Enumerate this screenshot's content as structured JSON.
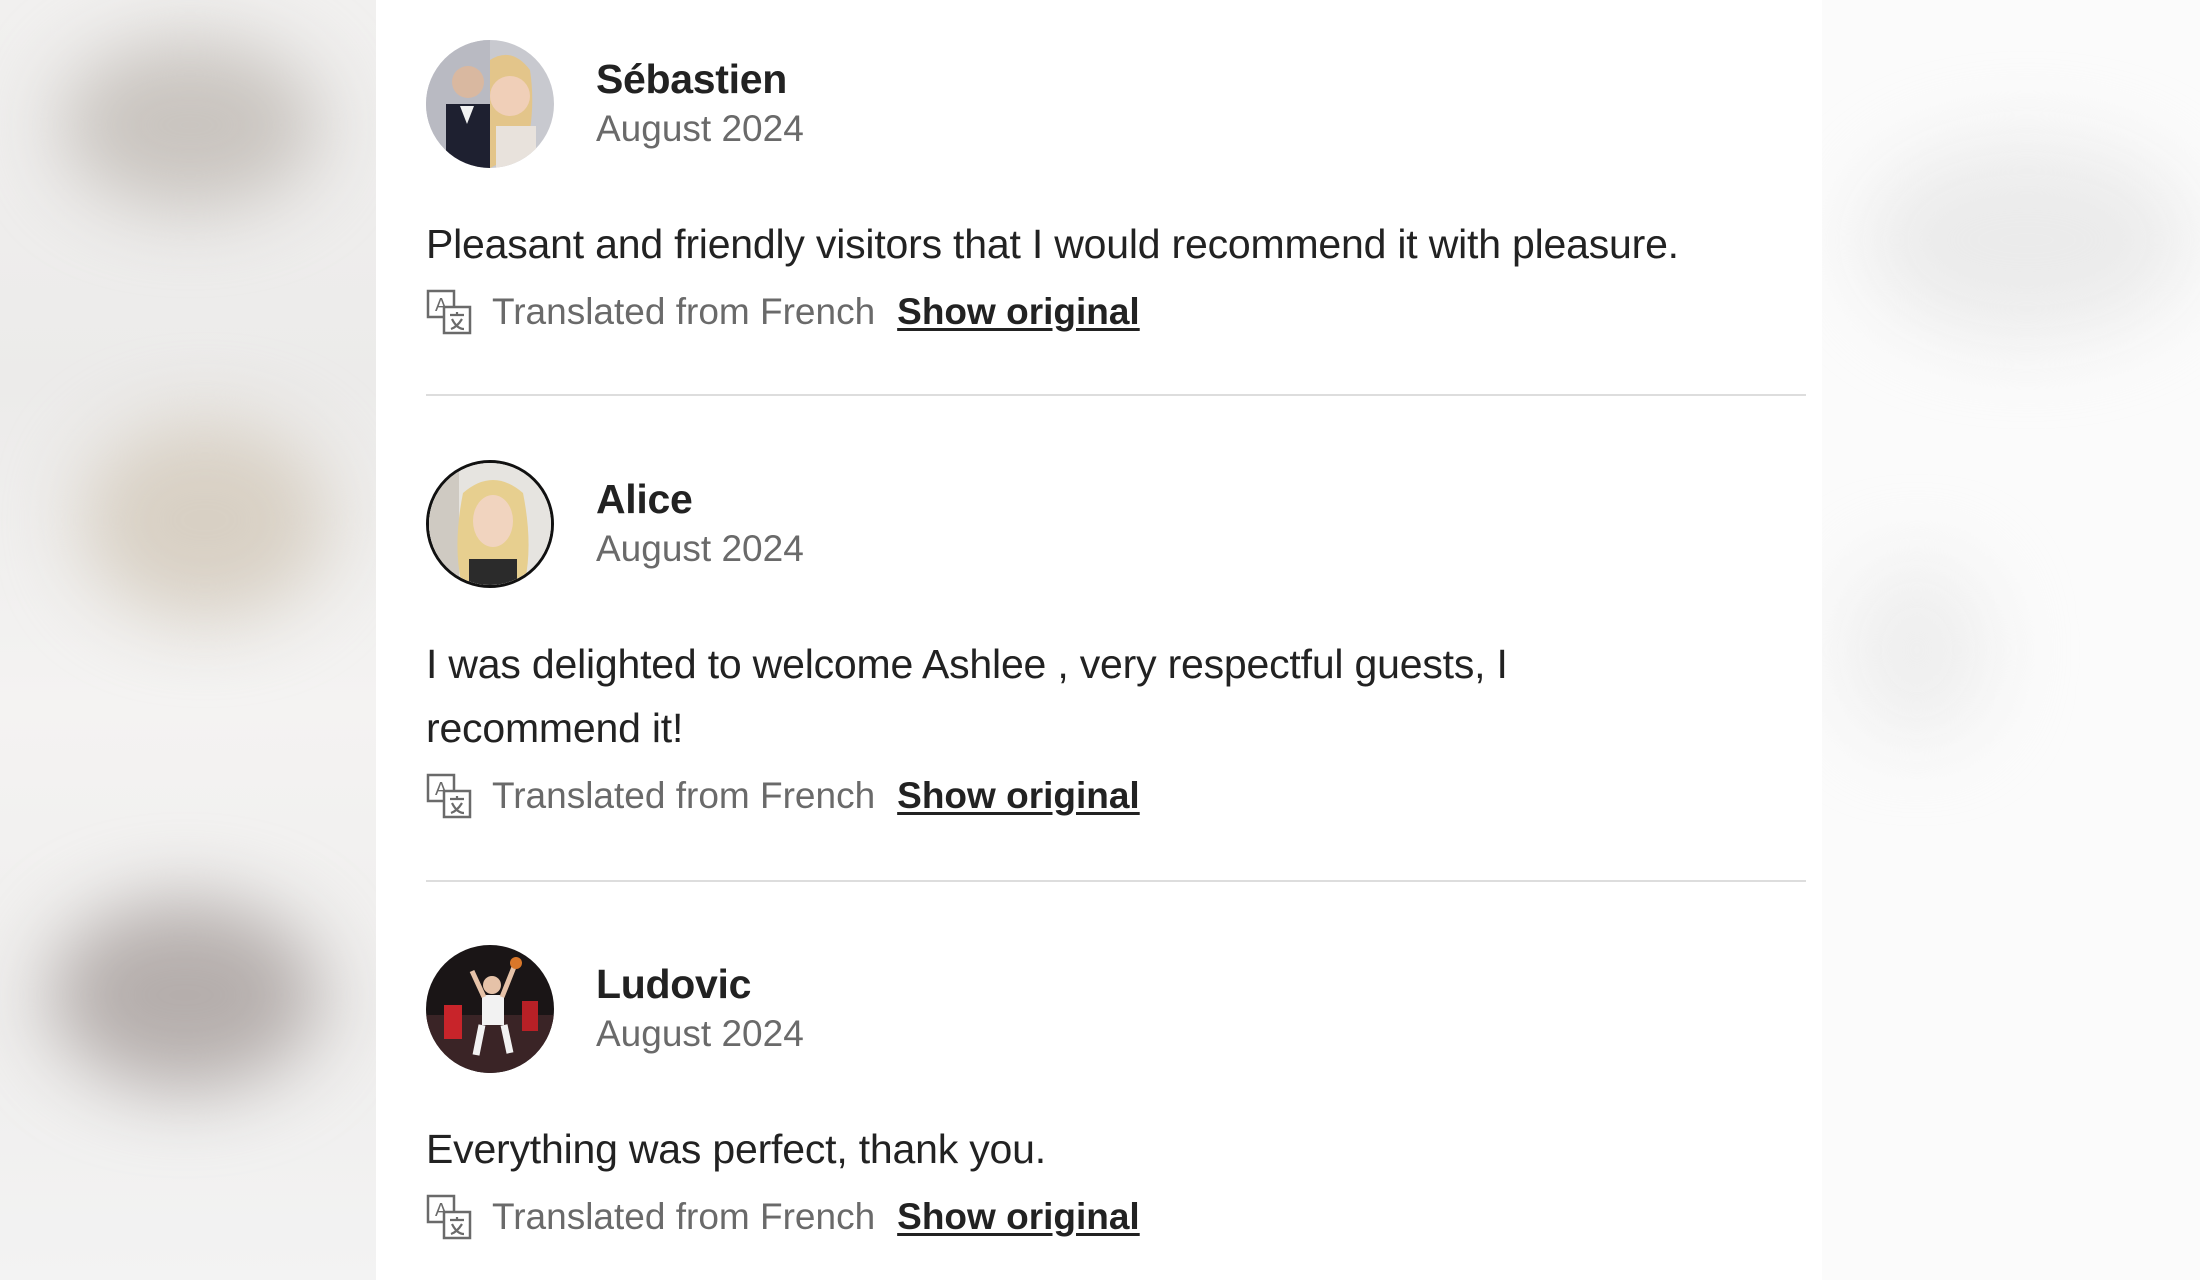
{
  "reviews": [
    {
      "name": "Sébastien",
      "date": "August 2024",
      "text": "Pleasant and friendly visitors that I would recommend it with pleasure.",
      "translated_label": "Translated from French",
      "show_original_label": "Show original",
      "avatar_icon": "couple-photo-avatar"
    },
    {
      "name": "Alice",
      "date": "August 2024",
      "text": "I was delighted to welcome Ashlee , very respectful guests, I recommend it!",
      "translated_label": "Translated from French",
      "show_original_label": "Show original",
      "avatar_icon": "woman-photo-avatar"
    },
    {
      "name": "Ludovic",
      "date": "August 2024",
      "text": "Everything was perfect, thank you.",
      "translated_label": "Translated from French",
      "show_original_label": "Show original",
      "avatar_icon": "basketball-photo-avatar"
    }
  ],
  "icons": {
    "translate": "translate-icon"
  },
  "colors": {
    "text_primary": "#222222",
    "text_secondary": "#6a6a6a",
    "divider": "#dddddd"
  }
}
